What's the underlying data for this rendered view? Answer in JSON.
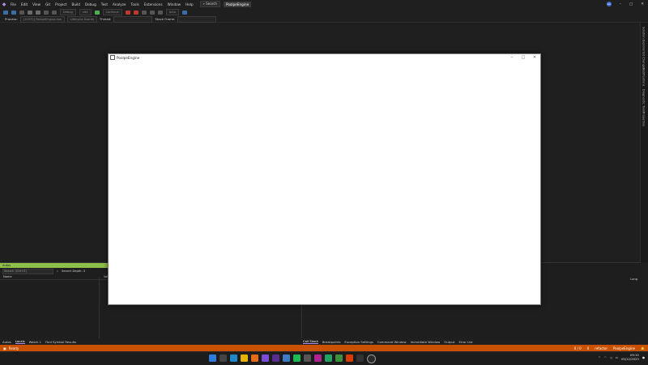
{
  "menubar": {
    "items": [
      "File",
      "Edit",
      "View",
      "Git",
      "Project",
      "Build",
      "Debug",
      "Test",
      "Analyze",
      "Tools",
      "Extensions",
      "Window",
      "Help"
    ],
    "search_label": "Search",
    "solution_name": "PoolpeEngine",
    "avatar_initials": "GC"
  },
  "toolbar": {
    "config": "Debug",
    "platform": "x64",
    "continue_label": "Continue",
    "search_hint": "Auto"
  },
  "process_bar": {
    "label": "Process:",
    "value": "[10972] PoolpeEngine.exe",
    "lifecycle": "Lifecycle Events",
    "thread": "Thread:",
    "stack": "Stack Frame:"
  },
  "right_strip": {
    "tabs": [
      "Solution Explorer",
      "Git Changes",
      "Notifications",
      "Diagnostic Tools",
      "Properties"
    ]
  },
  "locals": {
    "title": "Autos",
    "search_placeholder": "Search (Ctrl+E)",
    "search_depth": "Search Depth: 3",
    "col_name": "Name",
    "col_value": "Value"
  },
  "output": {
    "col_type": "Lang"
  },
  "left_tabs": [
    "Autos",
    "Locals",
    "Watch 1",
    "Find Symbol Results"
  ],
  "right_tabs": [
    "Call Stack",
    "Breakpoints",
    "Exception Settings",
    "Command Window",
    "Immediate Window",
    "Output",
    "Error List"
  ],
  "statusbar": {
    "ready": "Ready",
    "line": "0 / 0",
    "errors": "0",
    "branch": "refactor",
    "repo": "PoolpeEngine",
    "color": "#ca5100"
  },
  "taskbar": {
    "time": "09:10",
    "date": "05/12/2023"
  },
  "app_window": {
    "title": "PoolpeEngine",
    "minimize": "–",
    "maximize": "□",
    "close": "✕"
  }
}
